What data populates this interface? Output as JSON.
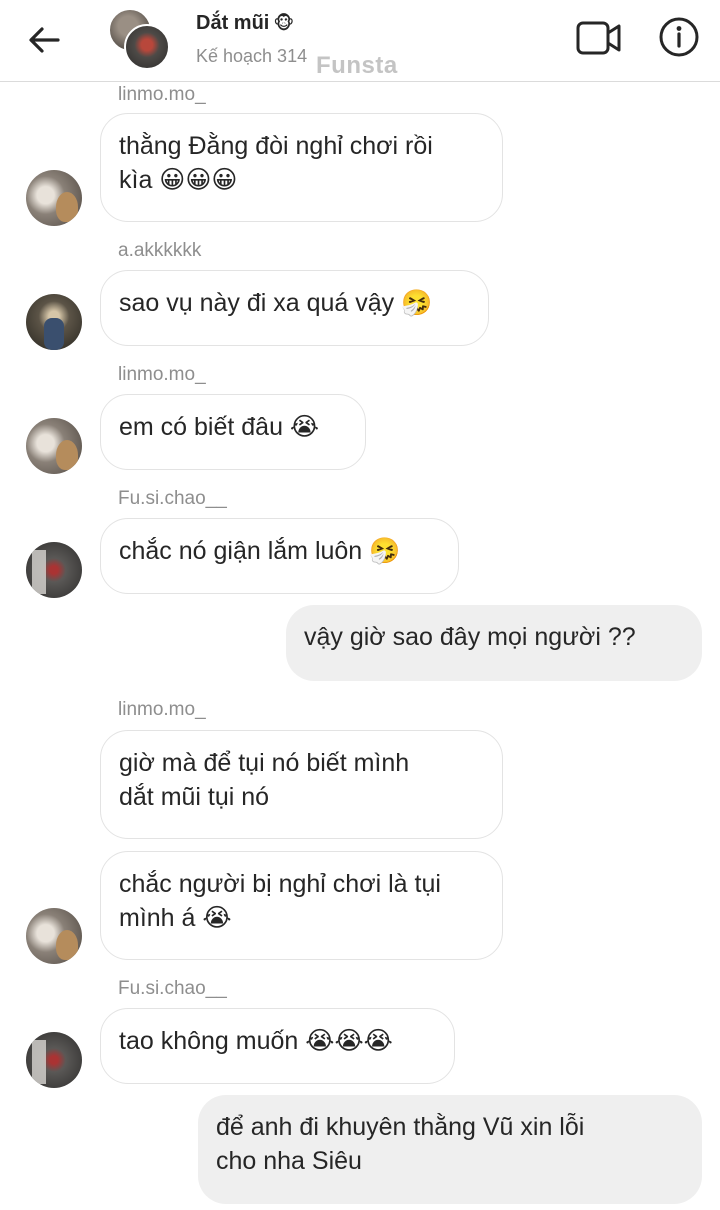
{
  "header": {
    "back_icon": "arrow-left-icon",
    "title": "Dắt mũi",
    "title_emoji": "🐵",
    "subtitle": "Kế hoạch 314",
    "watermark": "Funsta",
    "video_icon": "video-camera-icon",
    "info_icon": "info-icon"
  },
  "messages": [
    {
      "sender": "linmo.mo_",
      "text_lines": [
        "thằng Đằng đòi nghỉ chơi rồi",
        "kìa 😀😀😀"
      ]
    },
    {
      "sender": "a.akkkkkk",
      "text": "sao vụ này đi xa quá vậy 🤧"
    },
    {
      "sender": "linmo.mo_",
      "text": "em có biết đâu 😭"
    },
    {
      "sender": "Fu.si.chao__",
      "text": "chắc nó giận lắm luôn 🤧"
    },
    {
      "outgoing": true,
      "text": "vậy giờ sao đây mọi người ??"
    },
    {
      "sender": "linmo.mo_",
      "text_lines": [
        "giờ mà để tụi nó biết mình",
        "dắt mũi tụi nó"
      ]
    },
    {
      "text_lines": [
        "chắc người bị nghỉ chơi là tụi",
        "mình á 😭"
      ]
    },
    {
      "sender": "Fu.si.chao__",
      "text": "tao không muốn 😭😭😭"
    },
    {
      "outgoing": true,
      "text_lines": [
        "để anh đi khuyên thằng Vũ xin lỗi",
        "cho nha Siêu"
      ]
    }
  ]
}
